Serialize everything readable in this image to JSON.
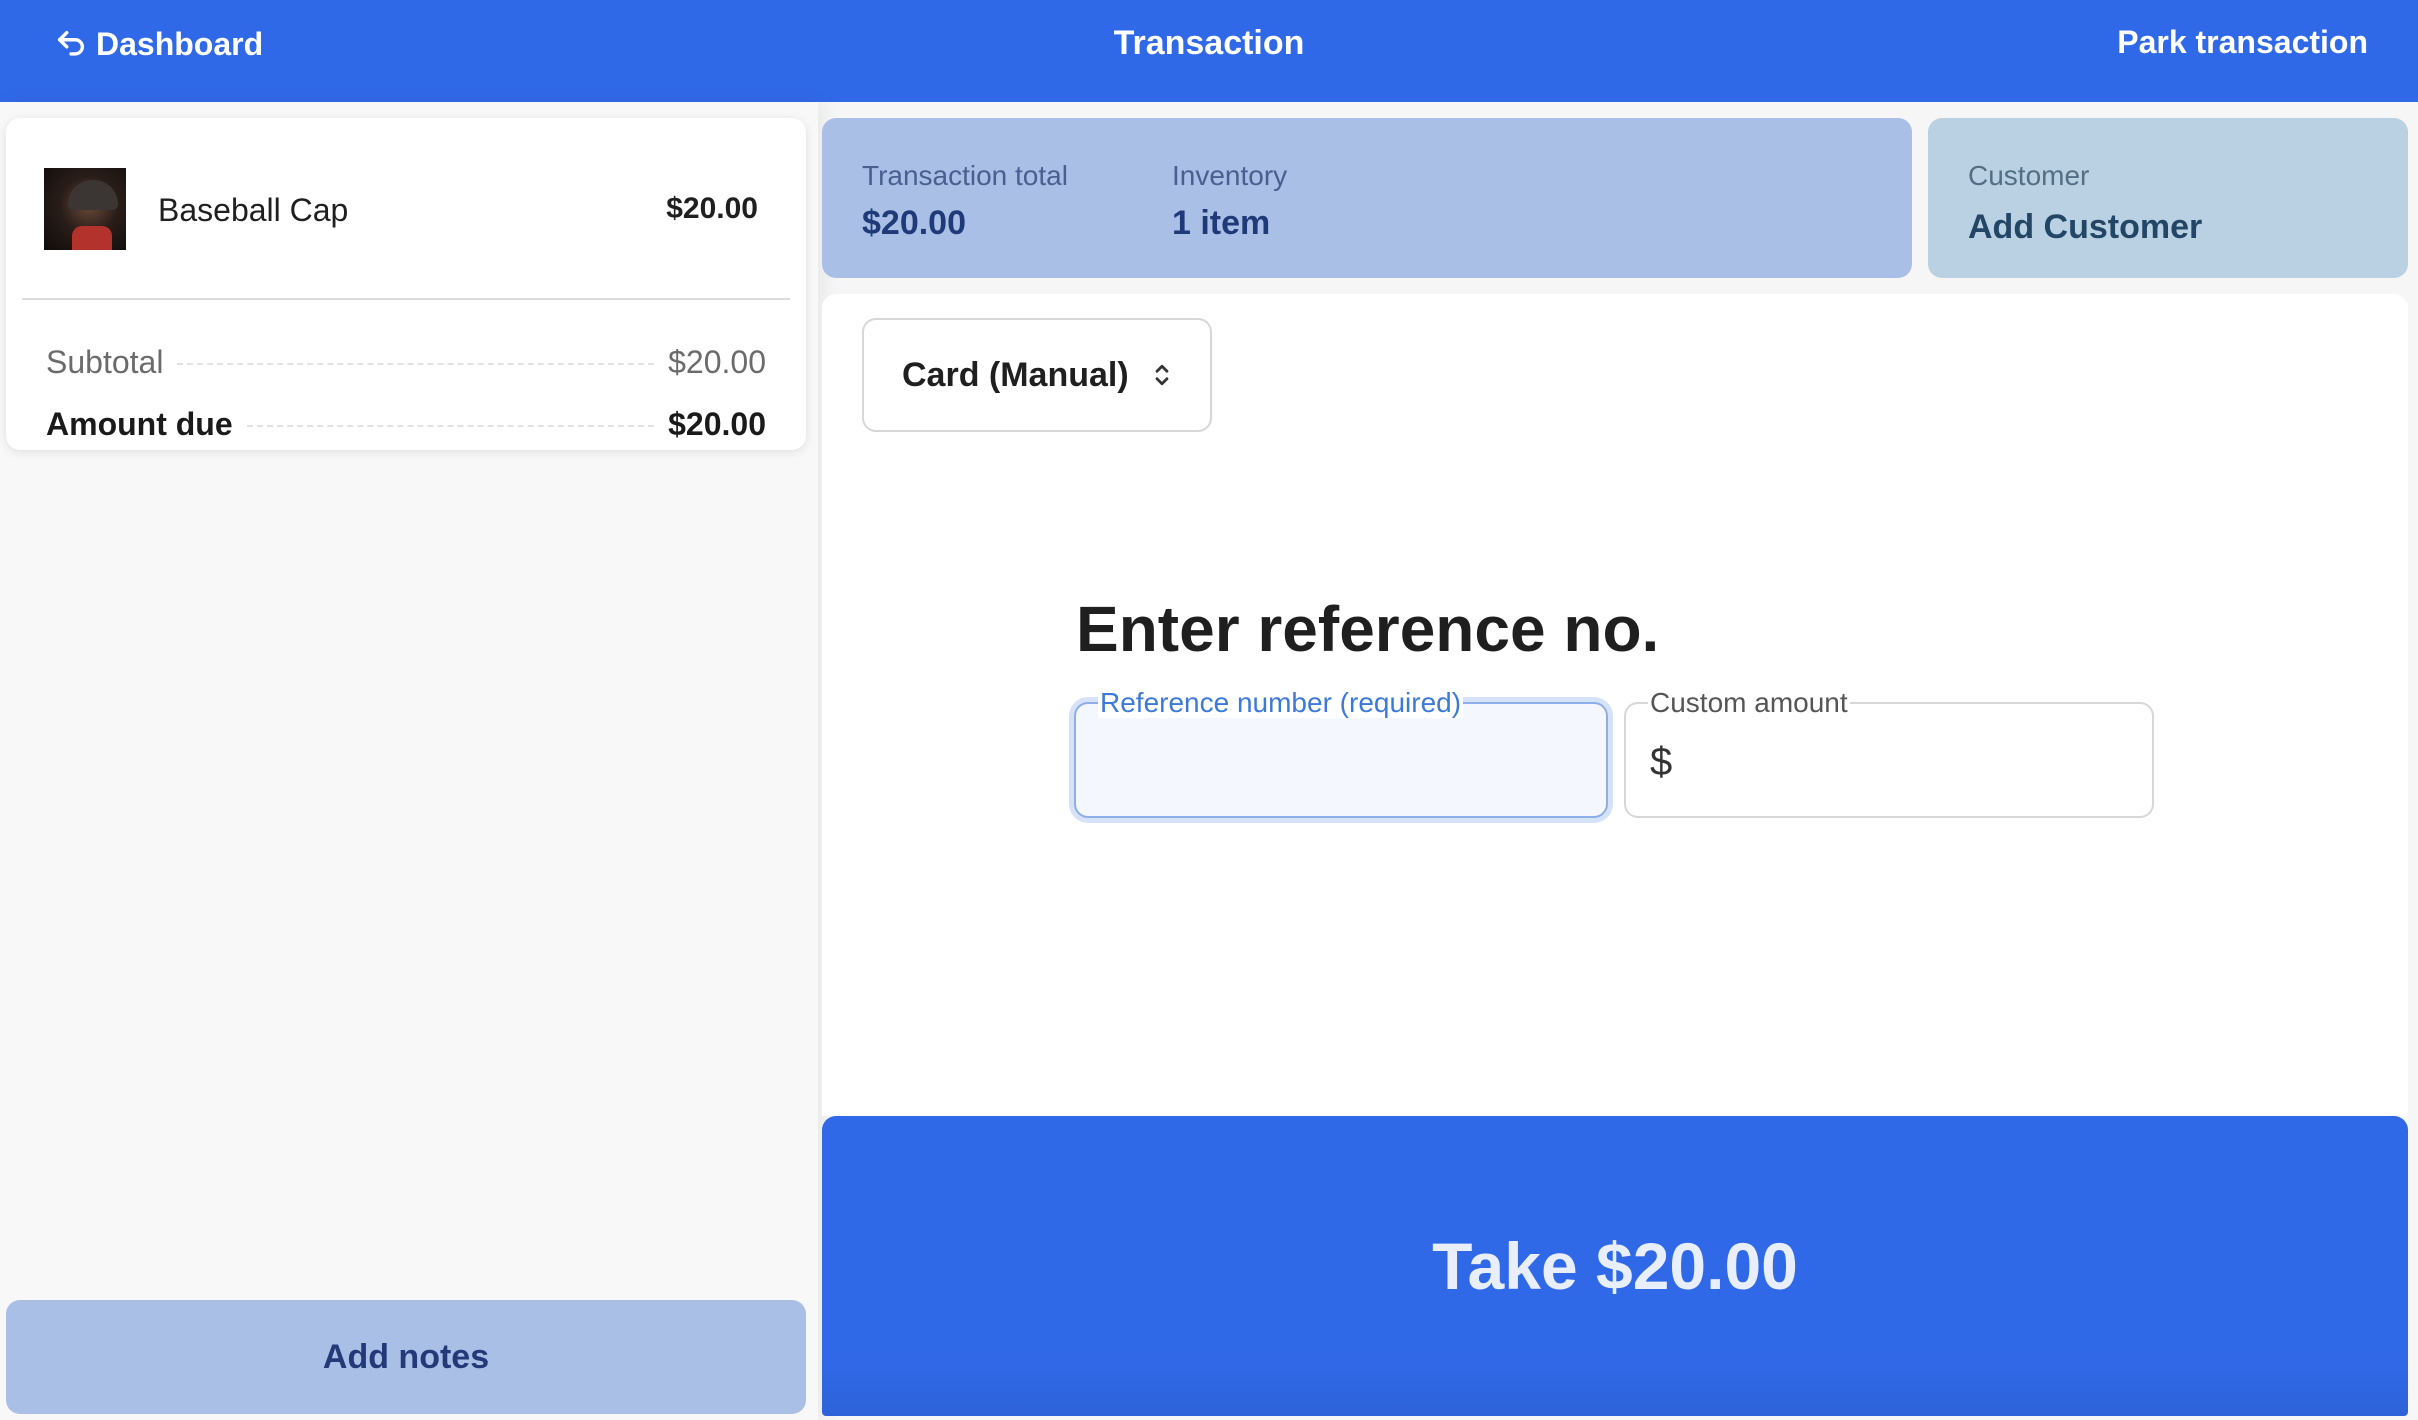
{
  "header": {
    "back_label": "Dashboard",
    "title": "Transaction",
    "park_label": "Park transaction"
  },
  "cart": {
    "items": [
      {
        "name": "Baseball Cap",
        "price": "$20.00"
      }
    ],
    "subtotal_label": "Subtotal",
    "subtotal_value": "$20.00",
    "amount_due_label": "Amount due",
    "amount_due_value": "$20.00",
    "add_notes_label": "Add notes"
  },
  "summary": {
    "total_label": "Transaction total",
    "total_value": "$20.00",
    "inventory_label": "Inventory",
    "inventory_value": "1 item"
  },
  "customer": {
    "label": "Customer",
    "action": "Add Customer"
  },
  "payment": {
    "method": "Card (Manual)",
    "heading": "Enter reference no.",
    "reference_label": "Reference number (required)",
    "reference_value": "",
    "custom_amount_label": "Custom amount",
    "currency_symbol": "$",
    "custom_amount_value": "",
    "take_label": "Take $20.00"
  },
  "colors": {
    "brand_blue": "#3069e8",
    "summary_tile": "#a9bfe6",
    "customer_tile": "#b9d1e2",
    "focus_border": "#8eaee8"
  }
}
